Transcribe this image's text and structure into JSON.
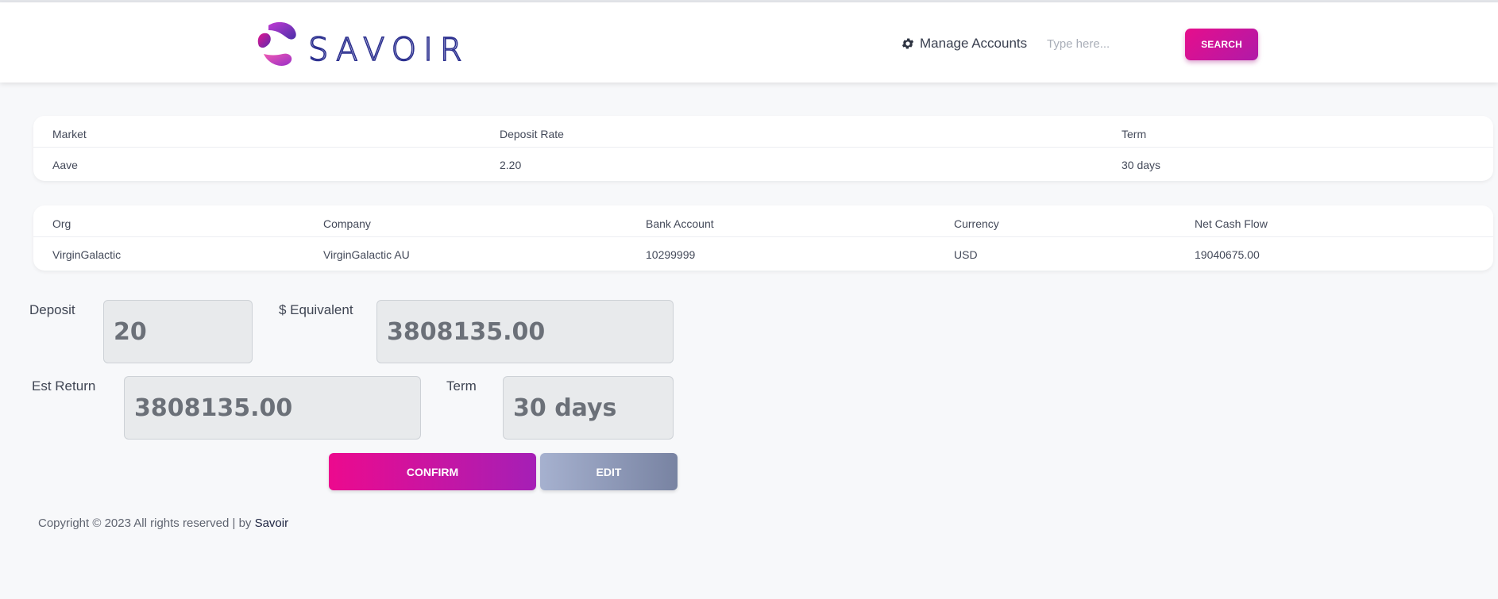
{
  "header": {
    "brand": "SAVOIR",
    "manage_accounts_label": "Manage Accounts",
    "manage_icon": "gear-icon",
    "search_placeholder": "Type here...",
    "search_button_label": "SEARCH"
  },
  "market_table": {
    "headers": [
      "Market",
      "Deposit Rate",
      "Term"
    ],
    "rows": [
      [
        "Aave",
        "2.20",
        "30 days"
      ]
    ]
  },
  "account_table": {
    "headers": [
      "Org",
      "Company",
      "Bank Account",
      "Currency",
      "Net Cash Flow"
    ],
    "rows": [
      [
        "VirginGalactic",
        "VirginGalactic AU",
        "10299999",
        "USD",
        "19040675.00"
      ]
    ]
  },
  "form": {
    "deposit_label": "Deposit",
    "deposit_value": "20",
    "equivalent_label": "$ Equivalent",
    "equivalent_value": "3808135.00",
    "est_return_label": "Est Return",
    "est_return_value": "3808135.00",
    "term_label": "Term",
    "term_value": "30 days"
  },
  "actions": {
    "confirm_label": "CONFIRM",
    "edit_label": "EDIT"
  },
  "footer": {
    "text": "Copyright © 2023 All rights reserved | by ",
    "brand": "Savoir"
  },
  "colors": {
    "accent_start": "#e60e8c",
    "accent_end": "#a51fb6",
    "brand_text": "#2b2f8f",
    "edit_start": "#a6b1cf",
    "edit_end": "#7883a2"
  }
}
